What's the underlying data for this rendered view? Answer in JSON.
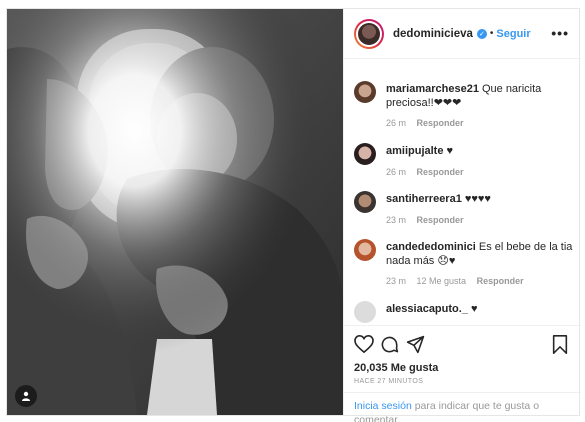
{
  "post": {
    "username": "dedominicieva",
    "follow_label": "Seguir",
    "separator": "•",
    "more_label": "•••"
  },
  "comments": [
    {
      "username": "mariamarchese21",
      "text": "Que naricita preciosa!!❤❤❤",
      "time": "26 m",
      "reply": "Responder",
      "likes": ""
    },
    {
      "username": "amiipujalte",
      "text": "♥",
      "time": "26 m",
      "reply": "Responder",
      "likes": ""
    },
    {
      "username": "santiherreera1",
      "text": "♥♥♥♥",
      "time": "23 m",
      "reply": "Responder",
      "likes": ""
    },
    {
      "username": "candededominici",
      "text": "Es el bebe de la tia nada más 😞♥",
      "time": "23 m",
      "likes": "12 Me gusta",
      "reply": "Responder"
    },
    {
      "username": "alessiacaputo._",
      "text": "♥",
      "time": "",
      "reply": "",
      "likes": ""
    }
  ],
  "stats": {
    "likes": "20,035 Me gusta",
    "time_ago": "HACE 27 MINUTOS"
  },
  "login_prompt": {
    "link": "Inicia sesión",
    "text": " para indicar que te gusta o comentar."
  },
  "icons": {
    "verified": "verified-badge-icon",
    "like": "heart-icon",
    "comment": "comment-bubble-icon",
    "share": "paper-plane-icon",
    "save": "bookmark-icon",
    "tag": "user-tag-icon"
  },
  "colors": {
    "accent": "#3897f0",
    "muted": "#999999",
    "text": "#262626",
    "border": "#efefef"
  }
}
